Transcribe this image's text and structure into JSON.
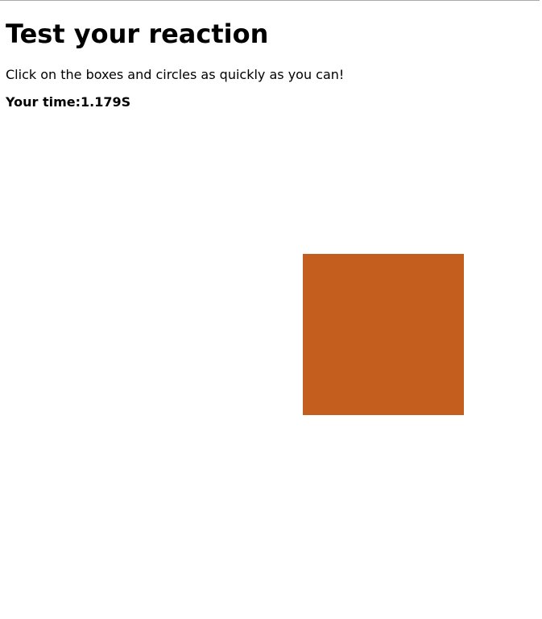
{
  "page": {
    "title": "Test your reaction",
    "instructions": "Click on the boxes and circles as quickly as you can!",
    "time_label": "Your time:",
    "time_value": "1.179S"
  },
  "target": {
    "shape": "box",
    "color": "#C45E1E"
  }
}
